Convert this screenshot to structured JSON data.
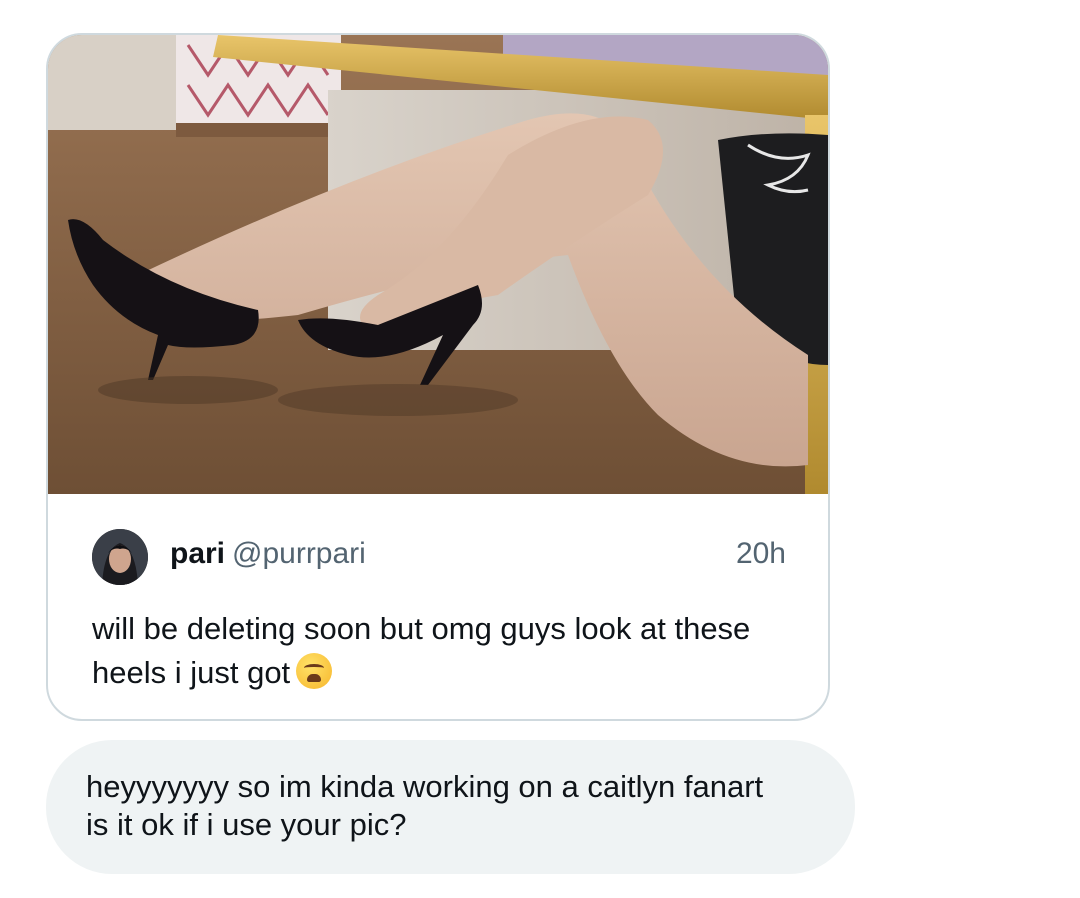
{
  "quoted_tweet": {
    "image": {
      "description_icon": "tweet-photo"
    },
    "author_name": "pari",
    "author_handle": "@purrpari",
    "time": "20h",
    "text": "will be deleting soon but omg guys look at these heels i just got",
    "emoji": "weary-face-icon"
  },
  "message": {
    "text": "heyyyyyyy so im kinda working on a caitlyn fanart is it ok if i use your pic?"
  },
  "colors": {
    "card_border": "#cfd9de",
    "bubble_bg": "#eff3f4",
    "primary_text": "#0f1419",
    "secondary_text": "#536471"
  }
}
